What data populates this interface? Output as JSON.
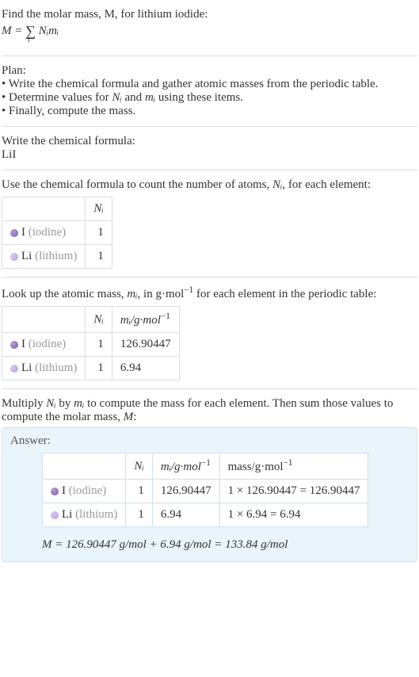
{
  "intro": {
    "line1": "Find the molar mass, M, for lithium iodide:",
    "formula_lhs": "M = ",
    "formula_sigma": "∑",
    "formula_sigma_sub": "i",
    "formula_rhs": "Nᵢmᵢ"
  },
  "plan": {
    "heading": "Plan:",
    "b1": "• Write the chemical formula and gather atomic masses from the periodic table.",
    "b2_pre": "• Determine values for ",
    "b2_ni": "Nᵢ",
    "b2_mid": " and ",
    "b2_mi": "mᵢ",
    "b2_post": " using these items.",
    "b3": "• Finally, compute the mass."
  },
  "formula_section": {
    "heading": "Write the chemical formula:",
    "value": "LiI"
  },
  "count_section": {
    "text_pre": "Use the chemical formula to count the number of atoms, ",
    "ni": "Nᵢ",
    "text_post": ", for each element:",
    "header_ni": "Nᵢ",
    "rows": [
      {
        "sym": "I",
        "name": "(iodine)",
        "ni": "1",
        "dot": "iodine"
      },
      {
        "sym": "Li",
        "name": "(lithium)",
        "ni": "1",
        "dot": "lithium"
      }
    ]
  },
  "mass_section": {
    "text_pre": "Look up the atomic mass, ",
    "mi": "mᵢ",
    "text_mid": ", in g·mol",
    "exp": "−1",
    "text_post": " for each element in the periodic table:",
    "header_ni": "Nᵢ",
    "header_mi_pre": "mᵢ/g·mol",
    "rows": [
      {
        "sym": "I",
        "name": "(iodine)",
        "ni": "1",
        "mi": "126.90447",
        "dot": "iodine"
      },
      {
        "sym": "Li",
        "name": "(lithium)",
        "ni": "1",
        "mi": "6.94",
        "dot": "lithium"
      }
    ]
  },
  "multiply_section": {
    "text_pre": "Multiply ",
    "ni": "Nᵢ",
    "text_mid1": " by ",
    "mi": "mᵢ",
    "text_mid2": " to compute the mass for each element. Then sum those values to compute the molar mass, ",
    "M": "M",
    "text_post": ":"
  },
  "answer": {
    "label": "Answer:",
    "header_ni": "Nᵢ",
    "header_mi_pre": "mᵢ/g·mol",
    "header_mass_pre": "mass/g·mol",
    "exp": "−1",
    "rows": [
      {
        "sym": "I",
        "name": "(iodine)",
        "ni": "1",
        "mi": "126.90447",
        "mass": "1 × 126.90447 = 126.90447",
        "dot": "iodine"
      },
      {
        "sym": "Li",
        "name": "(lithium)",
        "ni": "1",
        "mi": "6.94",
        "mass": "1 × 6.94 = 6.94",
        "dot": "lithium"
      }
    ],
    "final": "M = 126.90447 g/mol + 6.94 g/mol = 133.84 g/mol"
  }
}
